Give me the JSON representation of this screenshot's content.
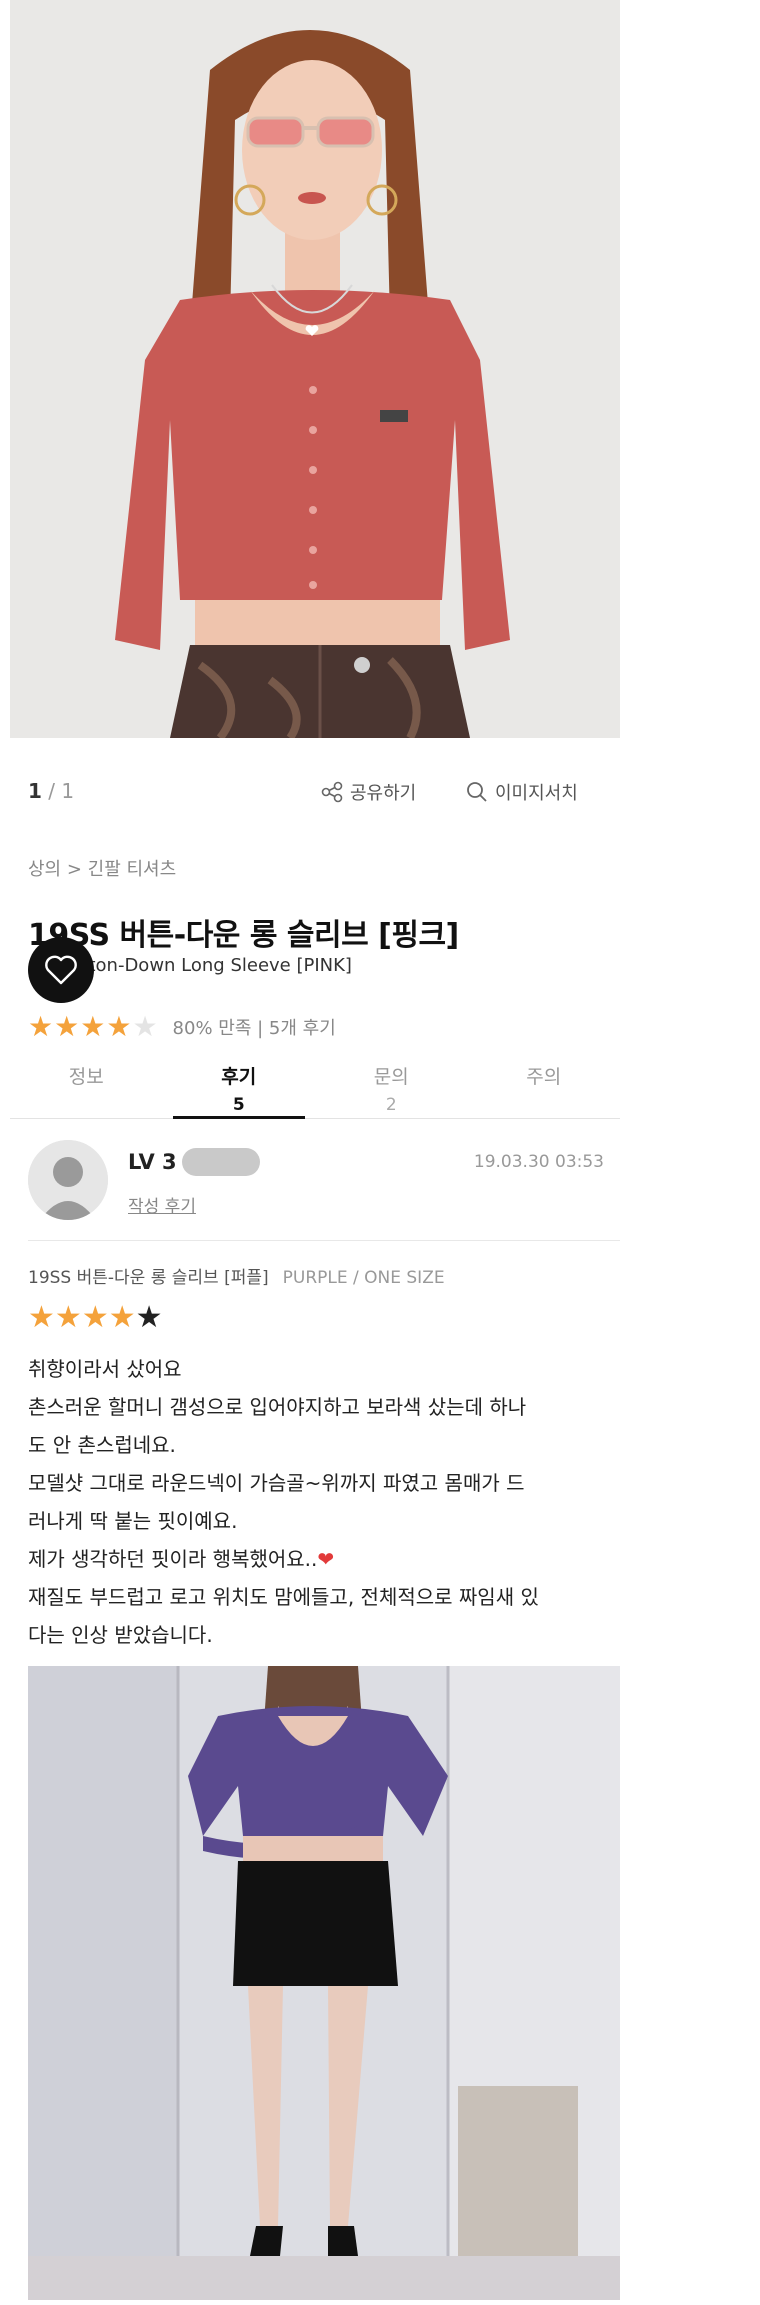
{
  "pager": {
    "current": "1",
    "total": "/ 1"
  },
  "actions": {
    "share_label": "공유하기",
    "image_search_label": "이미지서치"
  },
  "breadcrumb": {
    "text": "상의 > 긴팔 티셔츠"
  },
  "product": {
    "title": "19SS 버튼-다운 롱 슬리브 [핑크]",
    "subtitle": "utton-Down Long Sleeve [PINK]",
    "rating_stars": 4,
    "rating_text": "80% 만족 | 5개 후기"
  },
  "tabs": [
    {
      "label": "정보",
      "count": ""
    },
    {
      "label": "후기",
      "count": "5"
    },
    {
      "label": "문의",
      "count": "2"
    },
    {
      "label": "주의",
      "count": ""
    }
  ],
  "review": {
    "level": "LV 3",
    "write_link": "작성 후기",
    "date": "19.03.30 03:53",
    "product_name": "19SS 버튼-다운 롱 슬리브 [퍼플]",
    "option": "PURPLE / ONE SIZE",
    "stars": 4,
    "lines": [
      "취향이라서 샀어요",
      "촌스러운 할머니 갬성으로 입어야지하고 보라색 샀는데 하나",
      "도 안 촌스럽네요.",
      "모델샷 그대로 라운드넥이 가슴골~위까지 파였고 몸매가 드",
      "러나게 딱 붙는 핏이예요.",
      "제가 생각하던 핏이라 행복했어요..",
      "재질도 부드럽고 로고 위치도 맘에들고, 전체적으로 짜임새 있",
      "다는 인상 받았습니다."
    ]
  },
  "colors": {
    "star": "#f4a23b",
    "shirt_pink": "#c85a55",
    "shirt_purple": "#5a4a8f",
    "heart": "#e23a3a"
  }
}
